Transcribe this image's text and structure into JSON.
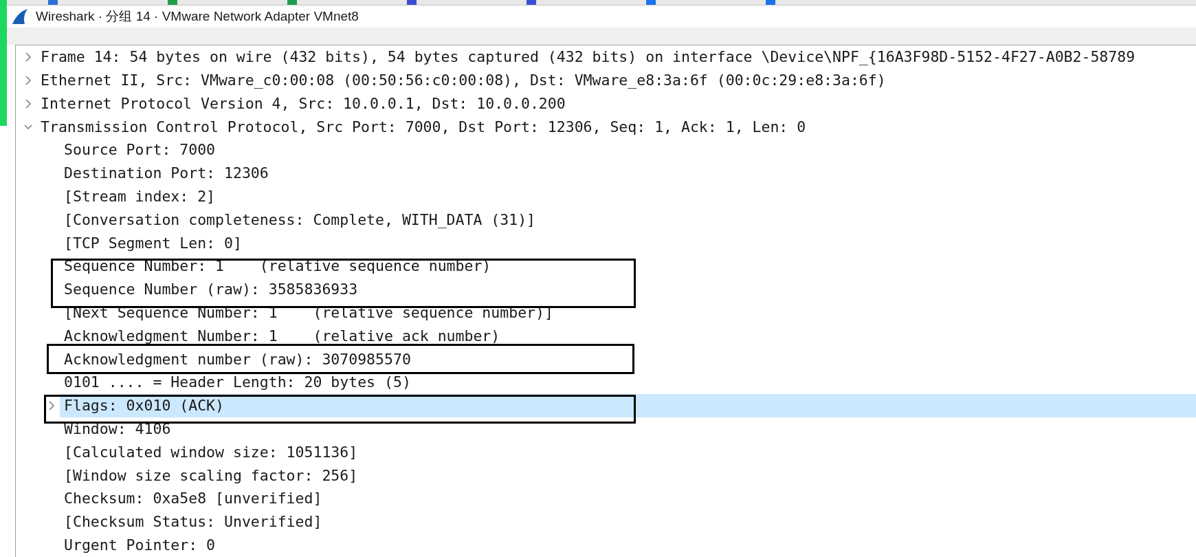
{
  "window": {
    "title": "Wireshark · 分组 14 · VMware Network Adapter VMnet8"
  },
  "tree": [
    {
      "label": "Frame 14: 54 bytes on wire (432 bits), 54 bytes captured (432 bits) on interface \\Device\\NPF_{16A3F98D-5152-4F27-A0B2-58789",
      "expanded": false,
      "selected": false
    },
    {
      "label": "Ethernet II, Src: VMware_c0:00:08 (00:50:56:c0:00:08), Dst: VMware_e8:3a:6f (00:0c:29:e8:3a:6f)",
      "expanded": false,
      "selected": false
    },
    {
      "label": "Internet Protocol Version 4, Src: 10.0.0.1, Dst: 10.0.0.200",
      "expanded": false,
      "selected": false
    },
    {
      "label": "Transmission Control Protocol, Src Port: 7000, Dst Port: 12306, Seq: 1, Ack: 1, Len: 0",
      "expanded": true,
      "selected": false,
      "children": [
        {
          "label": "Source Port: 7000",
          "selected": false
        },
        {
          "label": "Destination Port: 12306",
          "selected": false
        },
        {
          "label": "[Stream index: 2]",
          "selected": false
        },
        {
          "label": "[Conversation completeness: Complete, WITH_DATA (31)]",
          "selected": false
        },
        {
          "label": "[TCP Segment Len: 0]",
          "selected": false
        },
        {
          "label": "Sequence Number: 1    (relative sequence number)",
          "selected": false
        },
        {
          "label": "Sequence Number (raw): 3585836933",
          "selected": false
        },
        {
          "label": "[Next Sequence Number: 1    (relative sequence number)]",
          "selected": false
        },
        {
          "label": "Acknowledgment Number: 1    (relative ack number)",
          "selected": false
        },
        {
          "label": "Acknowledgment number (raw): 3070985570",
          "selected": false
        },
        {
          "label": "0101 .... = Header Length: 20 bytes (5)",
          "selected": false
        },
        {
          "label": "Flags: 0x010 (ACK)",
          "kind": "subtree",
          "expanded": false,
          "selected": true
        },
        {
          "label": "Window: 4106",
          "selected": false
        },
        {
          "label": "[Calculated window size: 1051136]",
          "selected": false
        },
        {
          "label": "[Window size scaling factor: 256]",
          "selected": false
        },
        {
          "label": "Checksum: 0xa5e8 [unverified]",
          "selected": false
        },
        {
          "label": "[Checksum Status: Unverified]",
          "selected": false
        },
        {
          "label": "Urgent Pointer: 0",
          "selected": false
        }
      ]
    }
  ]
}
